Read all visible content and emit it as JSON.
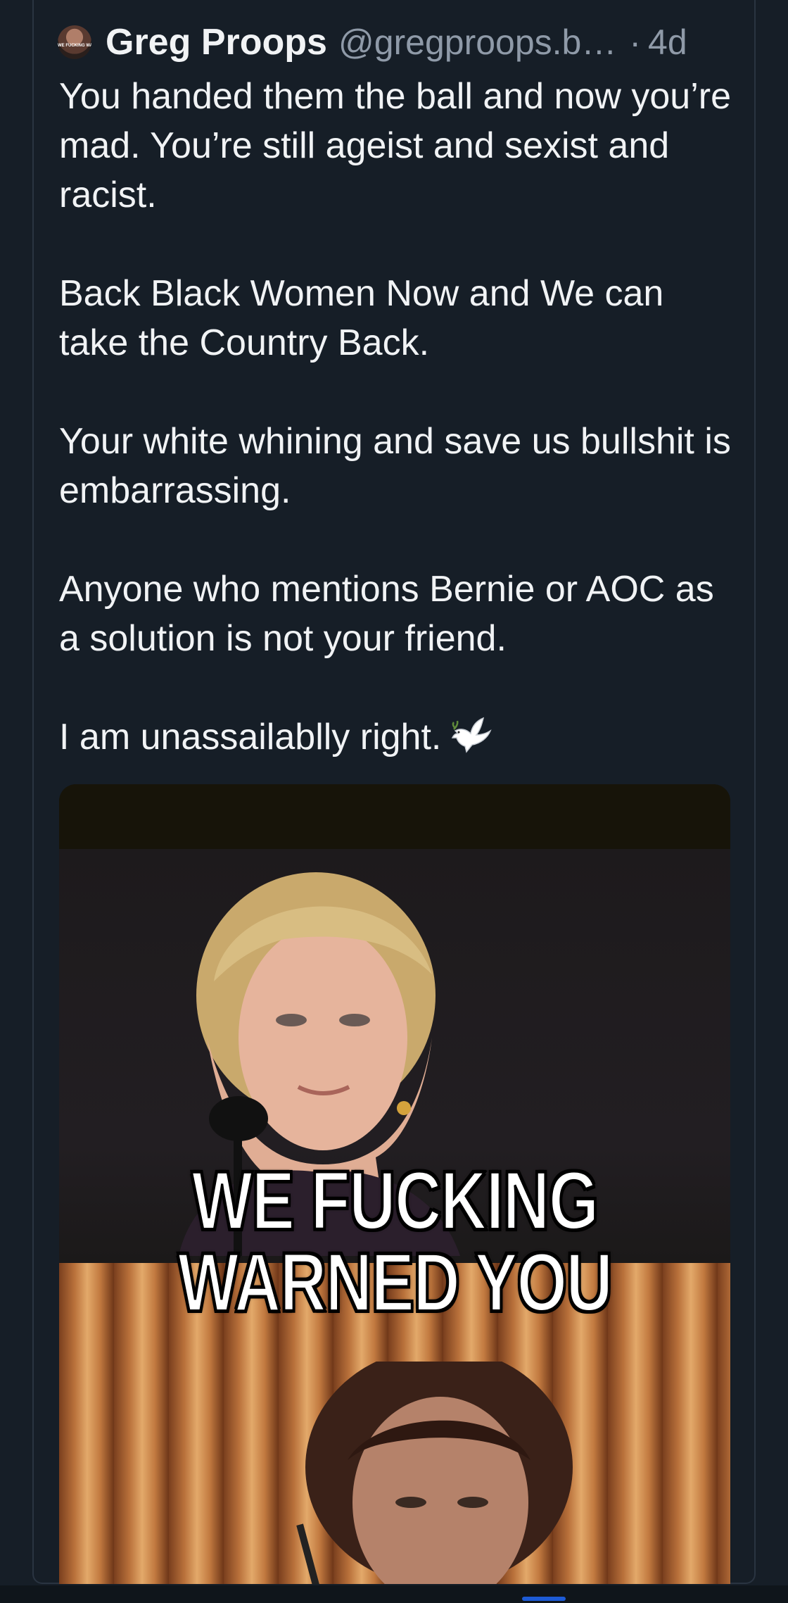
{
  "post": {
    "author": {
      "display_name": "Greg Proops",
      "handle": "@gregproops.b…",
      "avatar_text": "WE FUCKING WARNED YOU"
    },
    "separator": "·",
    "time": "4d",
    "paragraphs": [
      "You handed them the ball and now you’re mad. You’re still ageist and sexist and racist.",
      "Back Black Women Now and We can take the Country Back.",
      "Your white whining and save us bullshit is embarrassing.",
      "Anyone who mentions Bernie or AOC as a solution is not your friend.",
      "I am unassailablly right."
    ],
    "emoji": "dove-icon",
    "image": {
      "caption_line_1": "WE FUCKING",
      "caption_line_2": "WARNED YOU"
    }
  },
  "colors": {
    "background": "#161e27",
    "text": "#f1f3f5",
    "muted": "#8f9aa8",
    "accent": "#1d5bd6"
  }
}
